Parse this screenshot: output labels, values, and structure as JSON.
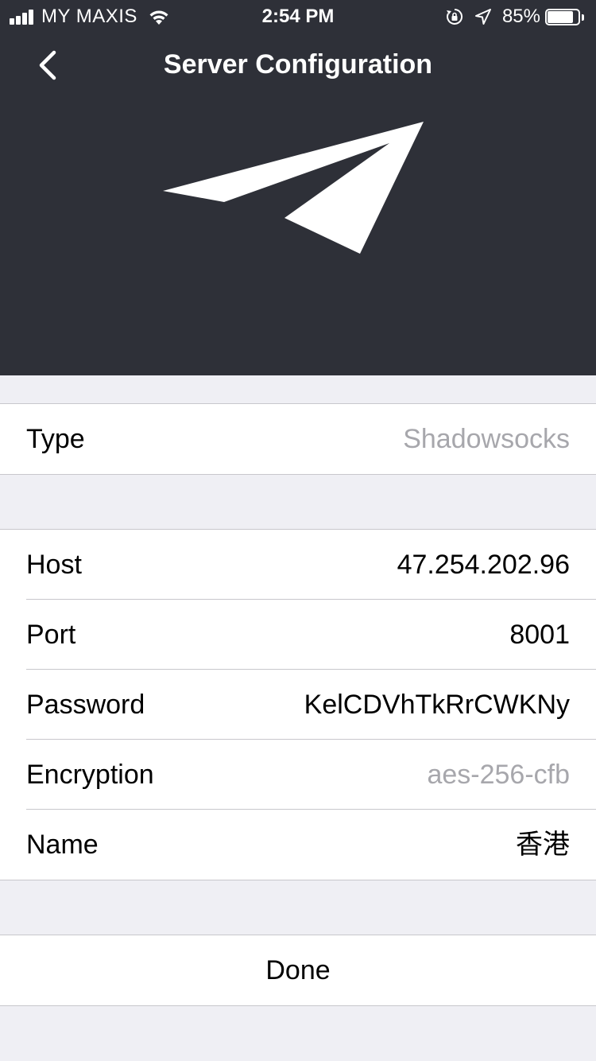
{
  "status_bar": {
    "carrier": "MY MAXIS",
    "time": "2:54 PM",
    "battery": "85%",
    "battery_level": 0.85
  },
  "nav": {
    "title": "Server Configuration",
    "back_icon": "chevron-left-icon"
  },
  "logo": {
    "icon": "paper-plane-logo",
    "color": "#ffffff"
  },
  "header_color": "#2e3038",
  "type_section": {
    "rows": [
      {
        "label": "Type",
        "value": "Shadowsocks"
      }
    ]
  },
  "server_section": {
    "rows": [
      {
        "label": "Host",
        "value": "47.254.202.96"
      },
      {
        "label": "Port",
        "value": "8001"
      },
      {
        "label": "Password",
        "value": "KelCDVhTkRrCWKNy"
      },
      {
        "label": "Encryption",
        "value": "aes-256-cfb"
      },
      {
        "label": "Name",
        "value": "香港"
      }
    ]
  },
  "actions": {
    "done_label": "Done"
  }
}
